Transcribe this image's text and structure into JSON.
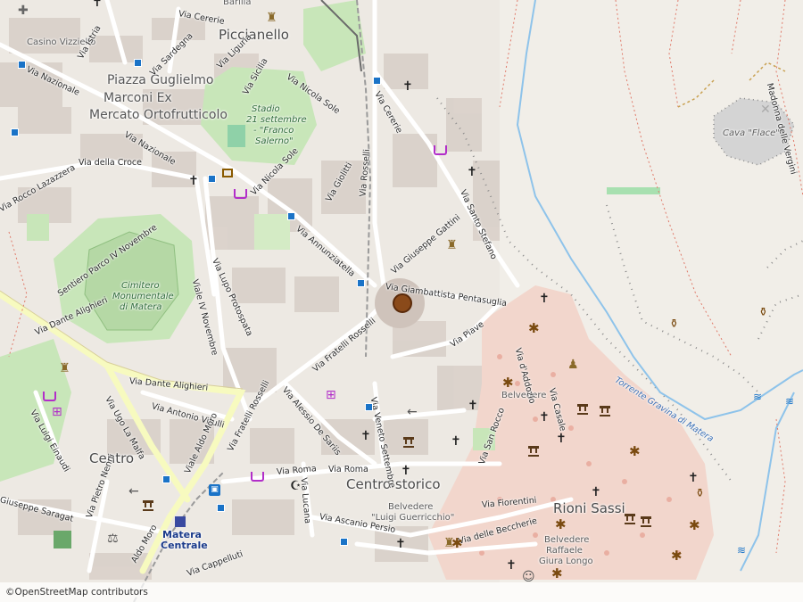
{
  "map": {
    "places": {
      "picchianello": "Piccianello",
      "piazza_line1": "Piazza Guglielmo",
      "piazza_line2": "Marconi Ex",
      "piazza_line3": "Mercato Ortofrutticolo",
      "centro": "Centro",
      "centro_storico": "Centro storico",
      "rioni_sassi": "Rioni Sassi",
      "casino": "Casino Vizziello",
      "barilla": "Barilla"
    },
    "pois": {
      "stadio_1": "Stadio",
      "stadio_2": "21 settembre",
      "stadio_3": "- \"Franco",
      "stadio_4": "Salerno\"",
      "cimitero_1": "Cimitero",
      "cimitero_2": "Monumentale",
      "cimitero_3": "di Matera",
      "cava_flace": "Cava \"Flace\"",
      "belvedere_1": "Belvedere",
      "belvedere_guerricchio_1": "Belvedere",
      "belvedere_guerricchio_2": "\"Luigi Guerricchio\"",
      "belvedere_giura_1": "Belvedere",
      "belvedere_giura_2": "Raffaele",
      "belvedere_giura_3": "Giura Longo",
      "station_1": "Matera",
      "station_2": "Centrale"
    },
    "streets": {
      "via_cererie_top": "Via Cererie",
      "via_istria": "Via Istria",
      "via_sardegna": "Via Sardegna",
      "via_liguria": "Via Liguria",
      "via_nazionale_1": "Via Nazionale",
      "via_nazionale_2": "Via Nazionale",
      "via_sicilia": "Via Sicilia",
      "via_nicola_sole_1": "Via Nicola Sole",
      "via_nicola_sole_2": "Via Nicola Sole",
      "via_cererie_2": "Via Cererie",
      "via_della_croce": "Via della Croce",
      "via_rocco_lazazzera": "Via Rocco Lazazzera",
      "via_giolitti": "Via Giolitti",
      "via_rosselli": "Via Rosselli",
      "via_santo_stefano": "Via Santo Stefano",
      "via_annunziatella": "Via Annunziatella",
      "via_giuseppe_gattini": "Via Giuseppe Gattini",
      "sentiero": "Sentiero Parco IV Novembre",
      "viale_iv_novembre": "Viale IV Novembre",
      "via_lupo_protospata": "Via Lupo Protospata",
      "via_pentasuglia": "Via Giambattista Pentasuglia",
      "via_fratelli_rosselli_1": "Via Fratelli Rosselli",
      "via_fratelli_rosselli_2": "Via Fratelli Rosselli",
      "via_piave": "Via Piave",
      "via_dante_1": "Via Dante Alighieri",
      "via_dante_2": "Via Dante Alighieri",
      "via_alessio_de_sariis": "Via Alessio De Sariis",
      "via_antonio_vitulli": "Via Antonio Vitulli",
      "via_ridola": "Via d'Addozio",
      "via_casale": "Via Casale",
      "via_luigi_einaudi": "Via Luigi Einaudi",
      "via_ugo_la_malfa": "Via Ugo La Malfa",
      "viale_aldo_moro_1": "Viale Aldo Moro",
      "viale_aldo_moro_2": "Aldo Moro",
      "via_xx_settembre": "Via Veneto Settembre",
      "via_roma_1": "Via Roma",
      "via_roma_2": "Via Roma",
      "via_lucana": "Via Lucana",
      "via_san_rocco": "Via San Rocco",
      "via_fiorentini": "Via Fiorentini",
      "via_ascanio_persio": "Via Ascanio Persio",
      "via_delle_beccherie": "Via delle Beccherie",
      "via_pietro_nenni": "Via Pietro Nenni",
      "giuseppe_saragat": "Giuseppe Saragat",
      "via_cappelluti": "Via Cappelluti",
      "madonna_vergini": "Madonna delle Vergini",
      "torrente": "Torrente Gravina di Matera"
    },
    "attribution": {
      "symbol": "©",
      "text": "OpenStreetMap contributors"
    },
    "colors": {
      "background": "#ede9e3",
      "park": "#c8e6b9",
      "river": "#8ec3ea",
      "road": "#ffffff",
      "major_road": "#f7fabf",
      "building": "#d9d0c9",
      "historic": "#e8b4a8",
      "rail": "#999999"
    }
  }
}
